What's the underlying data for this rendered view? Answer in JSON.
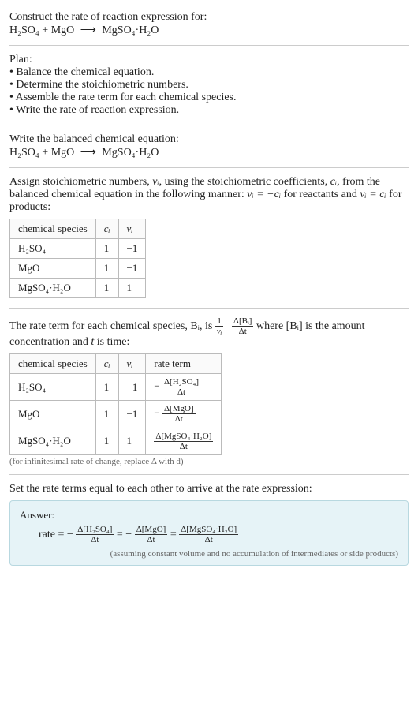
{
  "header": {
    "construct_label": "Construct the rate of reaction expression for:"
  },
  "equation": {
    "lhs1": "H₂SO₄",
    "plus": " + ",
    "lhs2": "MgO",
    "arrow": "⟶",
    "rhs": "MgSO₄·H₂O"
  },
  "plan": {
    "label": "Plan:",
    "items": [
      "• Balance the chemical equation.",
      "• Determine the stoichiometric numbers.",
      "• Assemble the rate term for each chemical species.",
      "• Write the rate of reaction expression."
    ]
  },
  "balanced": {
    "label": "Write the balanced chemical equation:"
  },
  "stoich_intro": {
    "text_pre": "Assign stoichiometric numbers, ",
    "nu_i": "νᵢ",
    "text_mid1": ", using the stoichiometric coefficients, ",
    "c_i": "cᵢ",
    "text_mid2": ", from the balanced chemical equation in the following manner: ",
    "rel_reactants": "νᵢ = −cᵢ",
    "text_mid3": " for reactants and ",
    "rel_products": "νᵢ = cᵢ",
    "text_end": " for products:"
  },
  "table1": {
    "headers": {
      "species": "chemical species",
      "ci": "cᵢ",
      "nui": "νᵢ"
    },
    "rows": [
      {
        "species": "H₂SO₄",
        "ci": "1",
        "nui": "−1"
      },
      {
        "species": "MgO",
        "ci": "1",
        "nui": "−1"
      },
      {
        "species": "MgSO₄·H₂O",
        "ci": "1",
        "nui": "1"
      }
    ]
  },
  "rate_term_intro": {
    "text_pre": "The rate term for each chemical species, Bᵢ, is ",
    "frac1_num": "1",
    "frac1_den": "νᵢ",
    "frac2_num": "Δ[Bᵢ]",
    "frac2_den": "Δt",
    "text_mid": " where [Bᵢ] is the amount concentration and ",
    "t": "t",
    "text_end": " is time:"
  },
  "table2": {
    "headers": {
      "species": "chemical species",
      "ci": "cᵢ",
      "nui": "νᵢ",
      "rate": "rate term"
    },
    "rows": [
      {
        "species": "H₂SO₄",
        "ci": "1",
        "nui": "−1",
        "sign": "−",
        "num": "Δ[H₂SO₄]",
        "den": "Δt"
      },
      {
        "species": "MgO",
        "ci": "1",
        "nui": "−1",
        "sign": "−",
        "num": "Δ[MgO]",
        "den": "Δt"
      },
      {
        "species": "MgSO₄·H₂O",
        "ci": "1",
        "nui": "1",
        "sign": "",
        "num": "Δ[MgSO₄·H₂O]",
        "den": "Δt"
      }
    ],
    "note": "(for infinitesimal rate of change, replace Δ with d)"
  },
  "final": {
    "label": "Set the rate terms equal to each other to arrive at the rate expression:"
  },
  "answer": {
    "label": "Answer:",
    "rate_label": "rate",
    "eq": " = ",
    "terms": [
      {
        "sign": "−",
        "num": "Δ[H₂SO₄]",
        "den": "Δt"
      },
      {
        "sign": "−",
        "num": "Δ[MgO]",
        "den": "Δt"
      },
      {
        "sign": "",
        "num": "Δ[MgSO₄·H₂O]",
        "den": "Δt"
      }
    ],
    "note": "(assuming constant volume and no accumulation of intermediates or side products)"
  }
}
